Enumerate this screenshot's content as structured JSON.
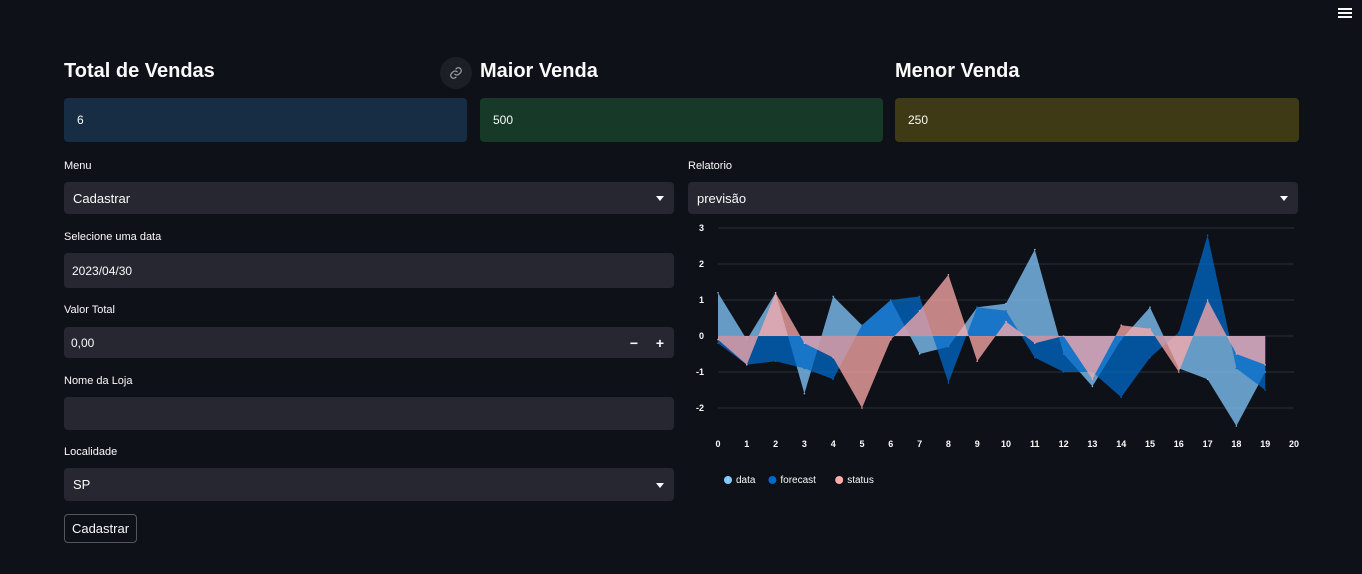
{
  "metrics": [
    {
      "title": "Total de Vendas",
      "value": "6",
      "color": "#172d43"
    },
    {
      "title": "Maior Venda",
      "value": "500",
      "color": "#173928"
    },
    {
      "title": "Menor Venda",
      "value": "250",
      "color": "#3e3a16"
    }
  ],
  "form": {
    "menu_label": "Menu",
    "menu_value": "Cadastrar",
    "date_label": "Selecione uma data",
    "date_value": "2023/04/30",
    "valor_label": "Valor Total",
    "valor_value": "0,00",
    "minus": "−",
    "plus": "+",
    "loja_label": "Nome da Loja",
    "loja_value": "",
    "local_label": "Localidade",
    "local_value": "SP",
    "submit_label": "Cadastrar"
  },
  "report": {
    "label": "Relatorio",
    "value": "previsão"
  },
  "chart_data": {
    "type": "area",
    "x": [
      0,
      1,
      2,
      3,
      4,
      5,
      6,
      7,
      8,
      9,
      10,
      11,
      12,
      13,
      14,
      15,
      16,
      17,
      18,
      19
    ],
    "xlim": [
      0,
      20
    ],
    "ylim": [
      -2.5,
      3
    ],
    "xticks": [
      0,
      1,
      2,
      3,
      4,
      5,
      6,
      7,
      8,
      9,
      10,
      11,
      12,
      13,
      14,
      15,
      16,
      17,
      18,
      19,
      20
    ],
    "yticks": [
      3,
      2,
      1,
      0,
      -1,
      -2
    ],
    "legend_position": "bottom-left",
    "series": [
      {
        "name": "data",
        "color": "#83c9ff",
        "values": [
          1.2,
          -0.1,
          1.2,
          -1.6,
          1.1,
          0.3,
          1.0,
          -0.5,
          -0.3,
          0.8,
          0.9,
          2.4,
          -0.5,
          -1.4,
          -0.1,
          0.8,
          -0.9,
          -1.2,
          -2.5,
          -1.0
        ]
      },
      {
        "name": "forecast",
        "color": "#0068c9",
        "values": [
          -0.2,
          -0.8,
          -0.7,
          -0.9,
          -1.2,
          0.3,
          1.0,
          1.1,
          -1.3,
          0.8,
          0.7,
          -0.6,
          -1.0,
          -1.0,
          -1.7,
          -0.6,
          0.1,
          2.8,
          -0.9,
          -1.5
        ]
      },
      {
        "name": "status",
        "color": "#ffabab",
        "values": [
          -0.1,
          -0.8,
          1.2,
          -0.2,
          -0.6,
          -2.0,
          -0.1,
          0.7,
          1.7,
          -0.7,
          0.4,
          -0.2,
          0.0,
          -1.2,
          0.3,
          0.2,
          -1.0,
          1.0,
          -0.5,
          -0.8
        ]
      }
    ]
  }
}
